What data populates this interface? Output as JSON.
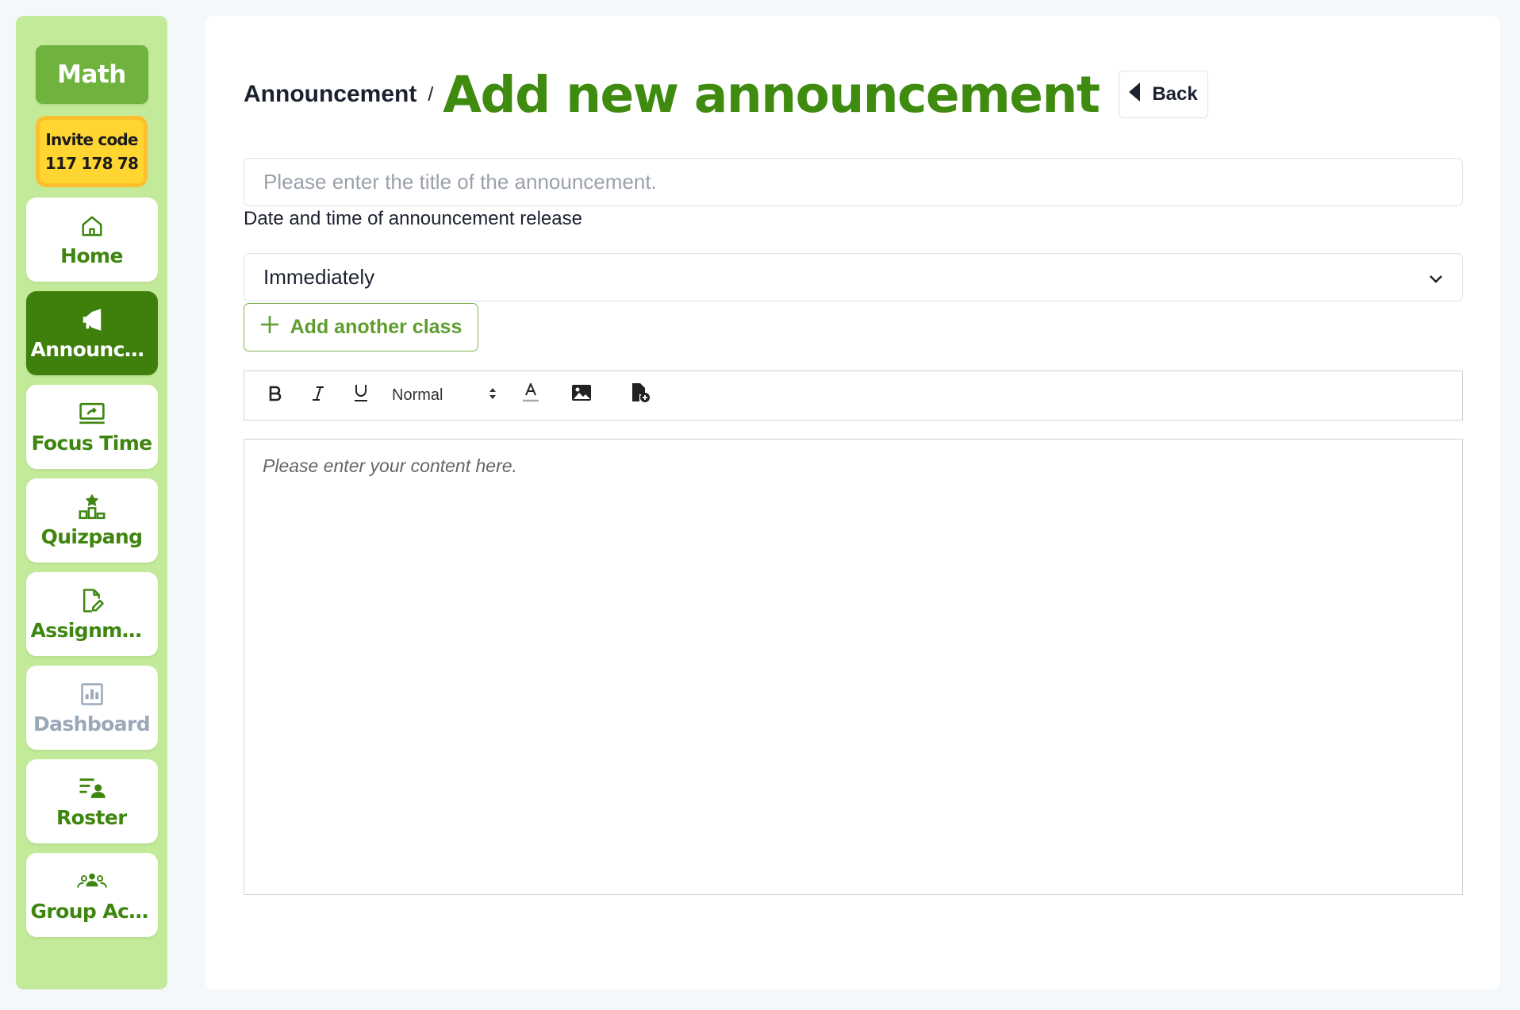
{
  "sidebar": {
    "class_name": "Math",
    "invite_label": "Invite code",
    "invite_code": "117 178 78",
    "items": [
      {
        "label": "Home",
        "icon": "home-icon"
      },
      {
        "label": "Announcements",
        "icon": "megaphone-icon"
      },
      {
        "label": "Focus Time",
        "icon": "monitor-icon"
      },
      {
        "label": "Quizpang",
        "icon": "podium-icon"
      },
      {
        "label": "Assignments",
        "icon": "edit-document-icon"
      },
      {
        "label": "Dashboard",
        "icon": "chart-icon"
      },
      {
        "label": "Roster",
        "icon": "roster-icon"
      },
      {
        "label": "Group Activities",
        "icon": "group-icon"
      }
    ]
  },
  "header": {
    "breadcrumb": "Announcement",
    "separator": "/",
    "title": "Add new announcement",
    "back_label": "Back"
  },
  "form": {
    "title_placeholder": "Please enter the title of the announcement.",
    "release_label": "Date and time of announcement release",
    "release_value": "Immediately",
    "add_class_label": "Add another class",
    "size_value": "Normal",
    "content_placeholder": "Please enter your content here."
  },
  "colors": {
    "sidebar_bg": "#c2ea98",
    "accent_green": "#3f8b0f",
    "active_green": "#3f800c",
    "invite_yellow": "#ffd531"
  }
}
